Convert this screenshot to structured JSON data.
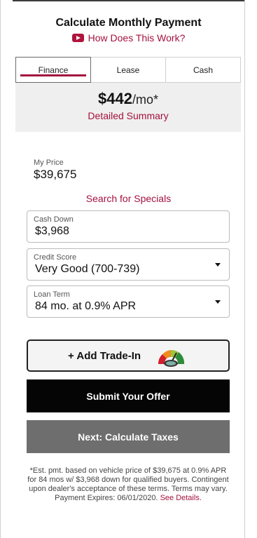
{
  "header": {
    "title": "Calculate Monthly Payment",
    "how_link": "How Does This Work?",
    "how_icon": "play-video-icon"
  },
  "tabs": [
    {
      "label": "Finance",
      "active": true
    },
    {
      "label": "Lease",
      "active": false
    },
    {
      "label": "Cash",
      "active": false
    }
  ],
  "summary": {
    "amount": "$442",
    "unit": "/mo*",
    "detailed_link": "Detailed Summary"
  },
  "my_price": {
    "label": "My Price",
    "value": "$39,675"
  },
  "specials_link": "Search for Specials",
  "fields": {
    "cash_down": {
      "label": "Cash Down",
      "value": "$3,968"
    },
    "credit_score": {
      "label": "Credit Score",
      "value": "Very Good (700-739)"
    },
    "loan_term": {
      "label": "Loan Term",
      "value": "84 mo. at 0.9% APR"
    }
  },
  "buttons": {
    "add_trade_in": "+ Add Trade-In",
    "submit_offer": "Submit Your Offer",
    "next_taxes": "Next: Calculate Taxes"
  },
  "disclaimer": {
    "text": "*Est. pmt. based on vehicle price of $39,675 at 0.9% APR for 84 mos w/ $3,968 down for qualified buyers. Contingent upon dealer's acceptance of these terms. Terms may vary. Payment Expires: 06/01/2020.",
    "link": "See Details."
  },
  "colors": {
    "accent": "#a4123f",
    "submit_bg": "#050505",
    "next_bg": "#6e6e6e",
    "summary_bg": "#efefef"
  }
}
